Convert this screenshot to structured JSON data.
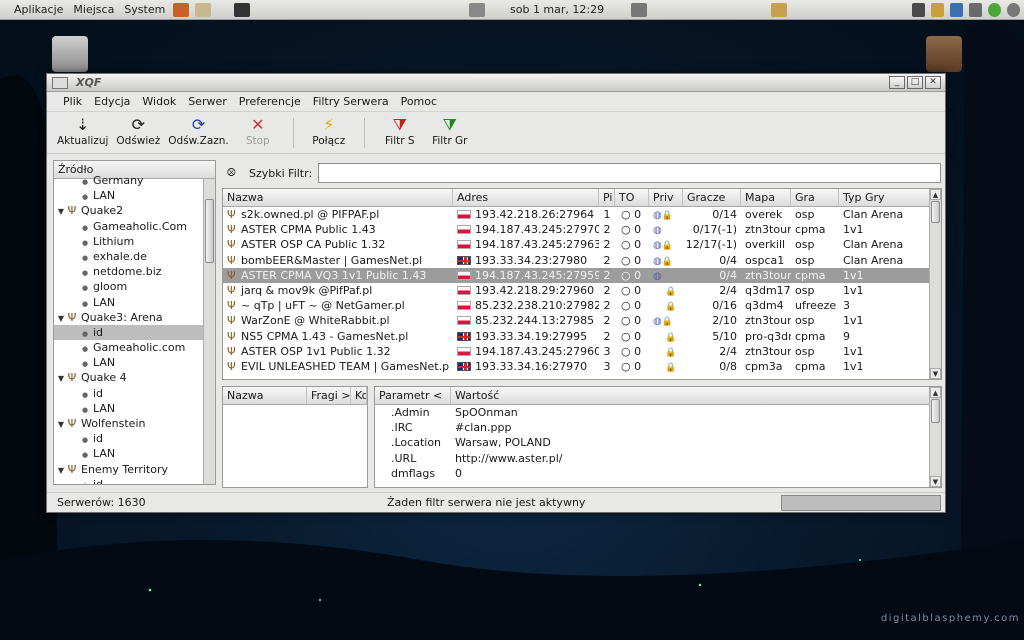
{
  "top_panel": {
    "menus": [
      "Aplikacje",
      "Miejsca",
      "System"
    ],
    "clock": "sob  1 mar, 12:29"
  },
  "window": {
    "title": "XQF",
    "menu": [
      "Plik",
      "Edycja",
      "Widok",
      "Serwer",
      "Preferencje",
      "Filtry Serwera",
      "Pomoc"
    ],
    "toolbar": [
      {
        "label": "Aktualizuj",
        "icon": "update-icon",
        "glyph": "⇣",
        "color": "#1a1a1a",
        "enabled": true
      },
      {
        "label": "Odśwież",
        "icon": "refresh-icon",
        "glyph": "⟳",
        "color": "#1a1a1a",
        "enabled": true
      },
      {
        "label": "Odśw.Zazn.",
        "icon": "refresh-selected-icon",
        "glyph": "⟳",
        "color": "#1f3f9a",
        "enabled": true
      },
      {
        "label": "Stop",
        "icon": "stop-icon",
        "glyph": "✕",
        "color": "#c83a3a",
        "enabled": false
      },
      {
        "label": "Połącz",
        "icon": "connect-icon",
        "glyph": "⚡",
        "color": "#e0b000",
        "enabled": true
      },
      {
        "label": "Filtr S",
        "icon": "server-filter-icon",
        "glyph": "⧩",
        "color": "#c82020",
        "enabled": true
      },
      {
        "label": "Filtr Gr",
        "icon": "player-filter-icon",
        "glyph": "⧩",
        "color": "#1a8a1a",
        "enabled": true
      }
    ],
    "source": {
      "header": "Źródło",
      "items": [
        {
          "label": "Germany",
          "level": 1,
          "kind": "leaf"
        },
        {
          "label": "LAN",
          "level": 1,
          "kind": "leaf"
        },
        {
          "label": "Quake2",
          "level": 0,
          "kind": "group"
        },
        {
          "label": "Gameaholic.Com",
          "level": 1,
          "kind": "leaf"
        },
        {
          "label": "Lithium",
          "level": 1,
          "kind": "leaf"
        },
        {
          "label": "exhale.de",
          "level": 1,
          "kind": "leaf"
        },
        {
          "label": "netdome.biz",
          "level": 1,
          "kind": "leaf"
        },
        {
          "label": "gloom",
          "level": 1,
          "kind": "leaf"
        },
        {
          "label": "LAN",
          "level": 1,
          "kind": "leaf"
        },
        {
          "label": "Quake3: Arena",
          "level": 0,
          "kind": "group"
        },
        {
          "label": "id",
          "level": 1,
          "kind": "leaf",
          "selected": true
        },
        {
          "label": "Gameaholic.com",
          "level": 1,
          "kind": "leaf"
        },
        {
          "label": "LAN",
          "level": 1,
          "kind": "leaf"
        },
        {
          "label": "Quake 4",
          "level": 0,
          "kind": "group"
        },
        {
          "label": "id",
          "level": 1,
          "kind": "leaf"
        },
        {
          "label": "LAN",
          "level": 1,
          "kind": "leaf"
        },
        {
          "label": "Wolfenstein",
          "level": 0,
          "kind": "group"
        },
        {
          "label": "id",
          "level": 1,
          "kind": "leaf"
        },
        {
          "label": "LAN",
          "level": 1,
          "kind": "leaf"
        },
        {
          "label": "Enemy Territory",
          "level": 0,
          "kind": "group"
        },
        {
          "label": "id",
          "level": 1,
          "kind": "leaf"
        }
      ]
    },
    "quick_filter": {
      "label": "Szybki Filtr:",
      "value": ""
    },
    "servers": {
      "columns": [
        "Nazwa",
        "Adres",
        "Pi",
        "TO",
        "Priv",
        "Gracze",
        "Mapa",
        "Gra",
        "Typ Gry"
      ],
      "rows": [
        {
          "name": "s2k.owned.pl @ PIFPAF.pl",
          "flag": "pl",
          "address": "193.42.218.26:27964",
          "ping": "1",
          "to": "○ 0",
          "priv": "globe-lock",
          "players": "0/14",
          "map": "overek",
          "game": "osp",
          "type": "Clan Arena"
        },
        {
          "name": "ASTER CPMA Public 1.43",
          "flag": "pl",
          "address": "194.187.43.245:27970",
          "ping": "2",
          "to": "○ 0",
          "priv": "globe",
          "players": "0/17(-1)",
          "map": "ztn3tour",
          "game": "cpma",
          "type": "1v1"
        },
        {
          "name": "ASTER OSP CA Public 1.32",
          "flag": "pl",
          "address": "194.187.43.245:27963",
          "ping": "2",
          "to": "○ 0",
          "priv": "globe-lock",
          "players": "12/17(-1)",
          "map": "overkill",
          "game": "osp",
          "type": "Clan Arena"
        },
        {
          "name": "bombEER&Master | GamesNet.pl",
          "flag": "gb",
          "address": "193.33.34.23:27980",
          "ping": "2",
          "to": "○ 0",
          "priv": "globe-lock",
          "players": "0/4",
          "map": "ospca1",
          "game": "osp",
          "type": "Clan Arena"
        },
        {
          "name": "ASTER CPMA VQ3 1v1 Public 1.43",
          "flag": "pl",
          "address": "194.187.43.245:27959",
          "ping": "2",
          "to": "○ 0",
          "priv": "globe",
          "players": "0/4",
          "map": "ztn3tour",
          "game": "cpma",
          "type": "1v1",
          "selected": true
        },
        {
          "name": "jarq & mov9k @PifPaf.pl",
          "flag": "pl",
          "address": "193.42.218.29:27960",
          "ping": "2",
          "to": "○ 0",
          "priv": "lock",
          "players": "2/4",
          "map": "q3dm17",
          "game": "osp",
          "type": "1v1"
        },
        {
          "name": "~ qTp | uFT ~ @ NetGamer.pl",
          "flag": "pl",
          "address": "85.232.238.210:27982",
          "ping": "2",
          "to": "○ 0",
          "priv": "lock",
          "players": "0/16",
          "map": "q3dm4",
          "game": "ufreeze",
          "type": "3"
        },
        {
          "name": "WarZonE  @ WhiteRabbit.pl",
          "flag": "pl",
          "address": "85.232.244.13:27985",
          "ping": "2",
          "to": "○ 0",
          "priv": "globe-lock",
          "players": "2/10",
          "map": "ztn3tour",
          "game": "osp",
          "type": "1v1"
        },
        {
          "name": "NS5 CPMA 1.43 - GamesNet.pl",
          "flag": "gb",
          "address": "193.33.34.19:27995",
          "ping": "2",
          "to": "○ 0",
          "priv": "lock",
          "players": "5/10",
          "map": "pro-q3dm",
          "game": "cpma",
          "type": "9"
        },
        {
          "name": "ASTER OSP 1v1 Public 1.32",
          "flag": "pl",
          "address": "194.187.43.245:27960",
          "ping": "3",
          "to": "○ 0",
          "priv": "lock",
          "players": "2/4",
          "map": "ztn3tour",
          "game": "osp",
          "type": "1v1"
        },
        {
          "name": "EVIL UNLEASHED TEAM | GamesNet.p",
          "flag": "gb",
          "address": "193.33.34.16:27970",
          "ping": "3",
          "to": "○ 0",
          "priv": "lock",
          "players": "0/8",
          "map": "cpm3a",
          "game": "cpma",
          "type": "1v1"
        }
      ]
    },
    "players": {
      "columns": [
        "Nazwa",
        "Fragi >",
        "Ko"
      ]
    },
    "params": {
      "columns": [
        "Parametr <",
        "Wartość"
      ],
      "rows": [
        {
          "key": ".Admin",
          "value": "SpOOnman"
        },
        {
          "key": ".IRC",
          "value": "#clan.ppp"
        },
        {
          "key": ".Location",
          "value": "Warsaw, POLAND"
        },
        {
          "key": ".URL",
          "value": "http://www.aster.pl/"
        },
        {
          "key": "dmflags",
          "value": "0"
        }
      ]
    },
    "status": {
      "servers": "Serwerów: 1630",
      "filter": "Żaden filtr serwera nie jest aktywny"
    }
  },
  "watermark": "digitalblasphemy.com"
}
